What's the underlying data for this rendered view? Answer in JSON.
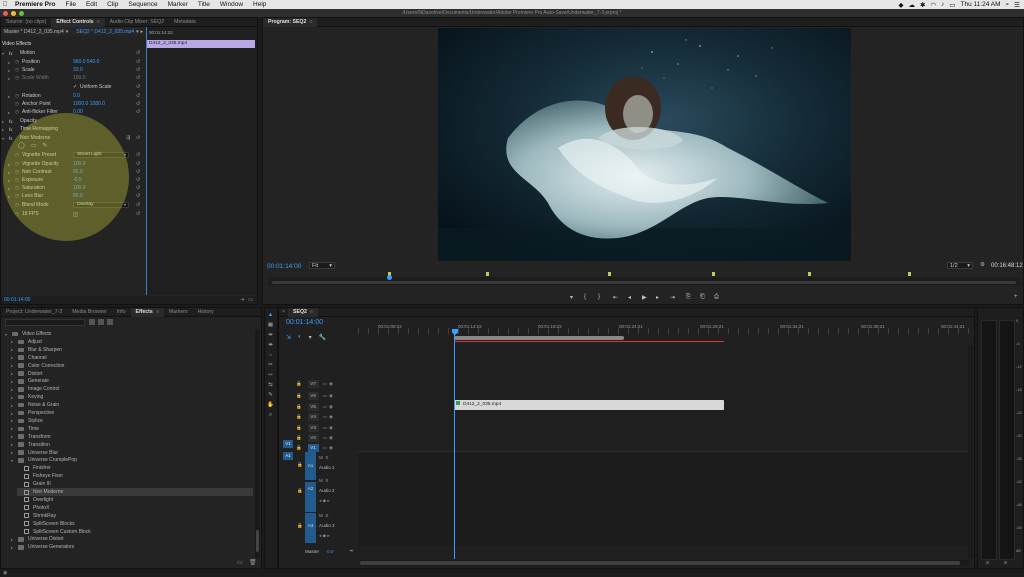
{
  "menubar": {
    "app": "Premiere Pro",
    "items": [
      "File",
      "Edit",
      "Clip",
      "Sequence",
      "Marker",
      "Title",
      "Window",
      "Help"
    ],
    "clock": "Thu 11:24 AM"
  },
  "window": {
    "title": "/Users/NDasot/ve/Documents/Underwater/Adobe Premiere Pro Auto-Save/Underwater_7-3.prproj *"
  },
  "colors": {
    "accent": "#3aa0ff",
    "clip": "#b9a7e6",
    "track_on": "#235b8e",
    "highlight": "#d2d23c"
  },
  "effect_controls": {
    "tabs": [
      "Source: (no clips)",
      "Effect Controls",
      "Audio Clip Mixer: SEQ2",
      "Metadata"
    ],
    "master": "Master * D412_2_035.mp4",
    "sequence": "SEQ2 * D412_2_035.mp4",
    "timecode_top": "00:01:14:22",
    "clip": "D412_2_035.mp4",
    "section": "Video Effects",
    "motion": "Motion",
    "rows": [
      {
        "label": "Position",
        "value": "960.0    540.0"
      },
      {
        "label": "Scale",
        "value": "33.0"
      },
      {
        "label": "Scale Width",
        "value": "100.0"
      },
      {
        "label": "Uniform Scale",
        "value": ""
      },
      {
        "label": "Rotation",
        "value": "0.0"
      },
      {
        "label": "Anchor Point",
        "value": "1000.0   1080.0"
      },
      {
        "label": "Anti-flicker Filter",
        "value": "0.00"
      }
    ],
    "opacity": "Opacity",
    "time_remapping": "Time Remapping",
    "noir": "Noir Moderne",
    "noir_rows": [
      {
        "label": "Vignette Preset",
        "value": "Street Light"
      },
      {
        "label": "Vignette Opacity",
        "value": "100.0"
      },
      {
        "label": "Noir Contrast",
        "value": "65.0"
      },
      {
        "label": "Exposure",
        "value": "-0.5"
      },
      {
        "label": "Saturation",
        "value": "100.0"
      },
      {
        "label": "Lens Blur",
        "value": "60.0"
      },
      {
        "label": "Blend Mode",
        "value": "Overlay"
      },
      {
        "label": "18 FPS",
        "value": ""
      }
    ],
    "timecode_bottom": "00:01:14:00"
  },
  "program": {
    "tab": "Program: SEQ2",
    "timecode": "00:01:14:00",
    "fit": "Fit",
    "quality": "1/2",
    "duration": "00:16:48:12"
  },
  "project": {
    "tabs": [
      "Project: Underwater_7-3",
      "Media Browser",
      "Info",
      "Effects",
      "Markers",
      "History"
    ],
    "items": [
      {
        "label": "Video Effects",
        "level": 0,
        "type": "folder"
      },
      {
        "label": "Adjust",
        "level": 1,
        "type": "folder"
      },
      {
        "label": "Blur & Sharpen",
        "level": 1,
        "type": "folder"
      },
      {
        "label": "Channel",
        "level": 1,
        "type": "folder"
      },
      {
        "label": "Color Correction",
        "level": 1,
        "type": "folder"
      },
      {
        "label": "Distort",
        "level": 1,
        "type": "folder"
      },
      {
        "label": "Generate",
        "level": 1,
        "type": "folder"
      },
      {
        "label": "Image Control",
        "level": 1,
        "type": "folder"
      },
      {
        "label": "Keying",
        "level": 1,
        "type": "folder"
      },
      {
        "label": "Noise & Grain",
        "level": 1,
        "type": "folder"
      },
      {
        "label": "Perspective",
        "level": 1,
        "type": "folder"
      },
      {
        "label": "Stylize",
        "level": 1,
        "type": "folder"
      },
      {
        "label": "Time",
        "level": 1,
        "type": "folder"
      },
      {
        "label": "Transform",
        "level": 1,
        "type": "folder"
      },
      {
        "label": "Transition",
        "level": 1,
        "type": "folder"
      },
      {
        "label": "Universe Blur",
        "level": 1,
        "type": "folder"
      },
      {
        "label": "Universe CrumplePop",
        "level": 1,
        "type": "folder"
      },
      {
        "label": "Finisher",
        "level": 2,
        "type": "effect"
      },
      {
        "label": "Fisheye Fixer",
        "level": 2,
        "type": "effect"
      },
      {
        "label": "Grain III",
        "level": 2,
        "type": "effect"
      },
      {
        "label": "Noir Moderne",
        "level": 2,
        "type": "effect"
      },
      {
        "label": "Overlight",
        "level": 2,
        "type": "effect"
      },
      {
        "label": "PhotoX",
        "level": 2,
        "type": "effect"
      },
      {
        "label": "ShrinkRay",
        "level": 2,
        "type": "effect"
      },
      {
        "label": "SplitScreen Blocks",
        "level": 2,
        "type": "effect"
      },
      {
        "label": "SplitScreen Custom Block",
        "level": 2,
        "type": "effect"
      },
      {
        "label": "Universe Distort",
        "level": 1,
        "type": "folder"
      },
      {
        "label": "Universe Generators",
        "level": 1,
        "type": "folder"
      }
    ]
  },
  "timeline": {
    "tab": "SEQ2",
    "timecode": "00:01:14:00",
    "ruler": [
      "00:01:09:22",
      "00:01:14:22",
      "00:01:19:22",
      "00:01:24:21",
      "00:01:29:21",
      "00:01:34:21",
      "00:01:39:21",
      "00:01:44:21"
    ],
    "video_tracks": [
      "V7",
      "V6",
      "V5",
      "V4",
      "V3",
      "V2",
      "V1"
    ],
    "audio_tracks": [
      {
        "id": "A1",
        "name": "Audio 1"
      },
      {
        "id": "A2",
        "name": "Audio 2"
      },
      {
        "id": "A3",
        "name": "Audio 3"
      }
    ],
    "master": "Master",
    "master_value": "0.0",
    "clip": "D412_2_035.mp4",
    "v1_src": "V1",
    "a1_src": "A1",
    "meter_labels": [
      "0",
      "-6",
      "-12",
      "-18",
      "-24",
      "-30",
      "-36",
      "-42",
      "-48",
      "-54",
      "dB"
    ],
    "meter_s": [
      "S",
      "S"
    ]
  }
}
